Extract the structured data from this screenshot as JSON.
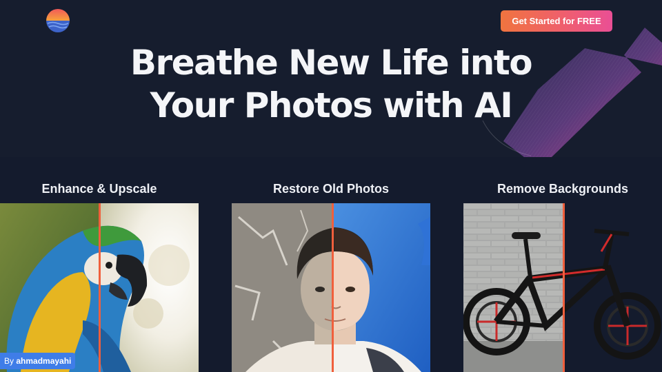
{
  "header": {
    "logo_icon": "sunset-logo-icon",
    "cta_label": "Get Started for FREE",
    "cta_gradient": [
      "#f0743f",
      "#ea4f95"
    ]
  },
  "hero": {
    "headline_line1": "Breathe New Life into",
    "headline_line2": "Your Photos with AI"
  },
  "features": [
    {
      "title": "Enhance & Upscale",
      "image": "macaw-parrot-photo"
    },
    {
      "title": "Restore Old Photos",
      "image": "old-portrait-boy-photo"
    },
    {
      "title": "Remove Backgrounds",
      "image": "mountain-bike-photo"
    }
  ],
  "credit": {
    "prefix": "By",
    "author": "ahmadmayahi"
  },
  "colors": {
    "background": "#141b2d",
    "divider": "#f05f3c",
    "credit_badge": "#3f7de8"
  }
}
